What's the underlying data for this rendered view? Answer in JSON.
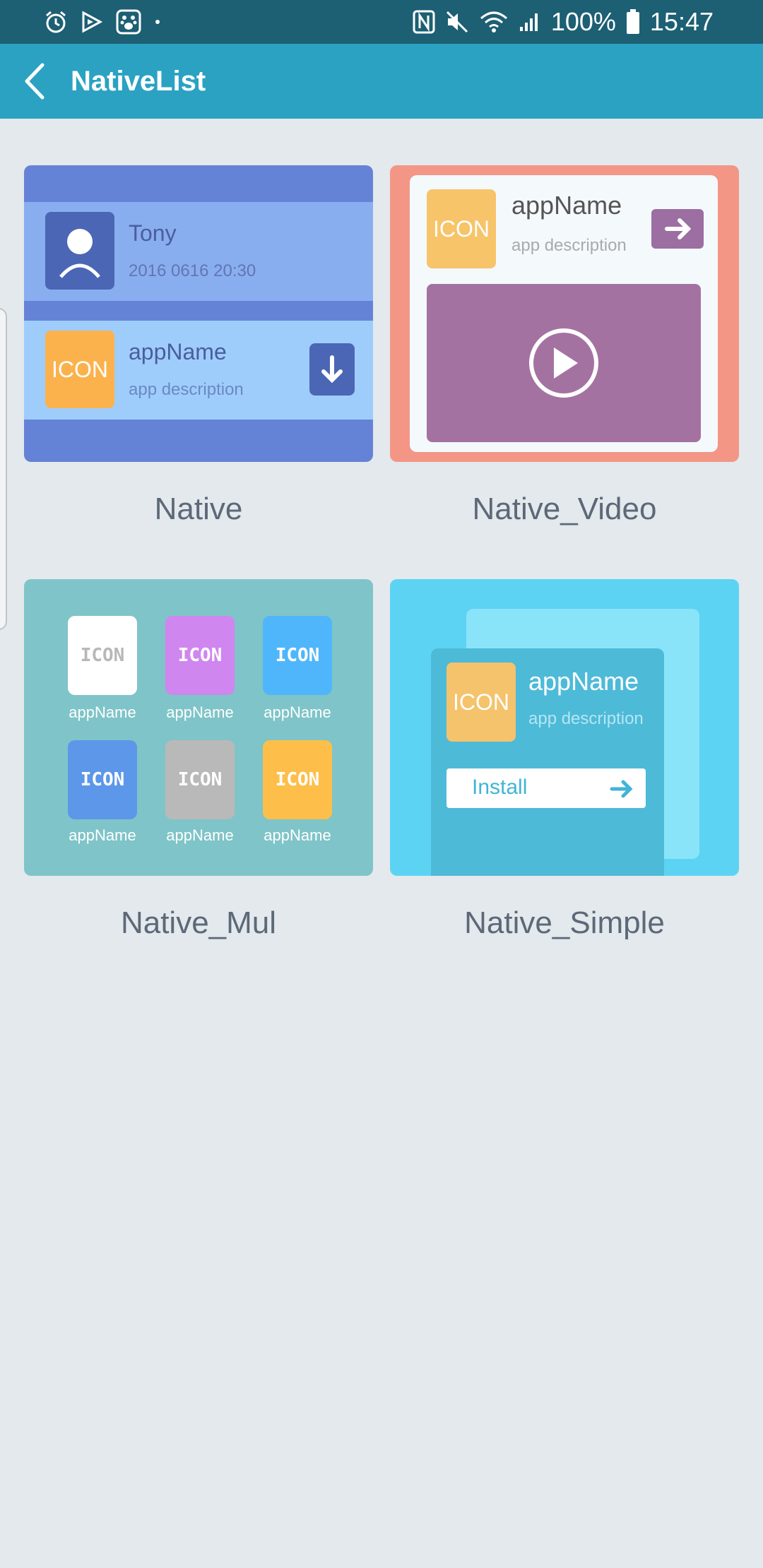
{
  "status_bar": {
    "battery": "100%",
    "time": "15:47"
  },
  "app_bar": {
    "title": "NativeList"
  },
  "items": [
    {
      "label": "Native",
      "preview": {
        "user_name": "Tony",
        "user_date": "2016 0616 20:30",
        "icon_text": "ICON",
        "app_name": "appName",
        "app_desc": "app description"
      }
    },
    {
      "label": "Native_Video",
      "preview": {
        "icon_text": "ICON",
        "app_name": "appName",
        "app_desc": "app description"
      }
    },
    {
      "label": "Native_Mul",
      "preview": {
        "cells": [
          {
            "icon_text": "ICON",
            "name": "appName"
          },
          {
            "icon_text": "ICON",
            "name": "appName"
          },
          {
            "icon_text": "ICON",
            "name": "appName"
          },
          {
            "icon_text": "ICON",
            "name": "appName"
          },
          {
            "icon_text": "ICON",
            "name": "appName"
          },
          {
            "icon_text": "ICON",
            "name": "appName"
          }
        ]
      }
    },
    {
      "label": "Native_Simple",
      "preview": {
        "icon_text": "ICON",
        "app_name": "appName",
        "app_desc": "app description",
        "install_label": "Install"
      }
    }
  ],
  "colors": {
    "status_bar": "#1d5f73",
    "app_bar": "#2ba2c2",
    "background": "#e3e9ec",
    "label_text": "#5d6878"
  },
  "icons": [
    "alarm-icon",
    "navigation-icon",
    "paw-icon",
    "nfc-icon",
    "mute-icon",
    "wifi-icon",
    "signal-icon",
    "battery-icon",
    "back-arrow-icon",
    "avatar-icon",
    "download-icon",
    "arrow-right-icon",
    "play-icon"
  ]
}
